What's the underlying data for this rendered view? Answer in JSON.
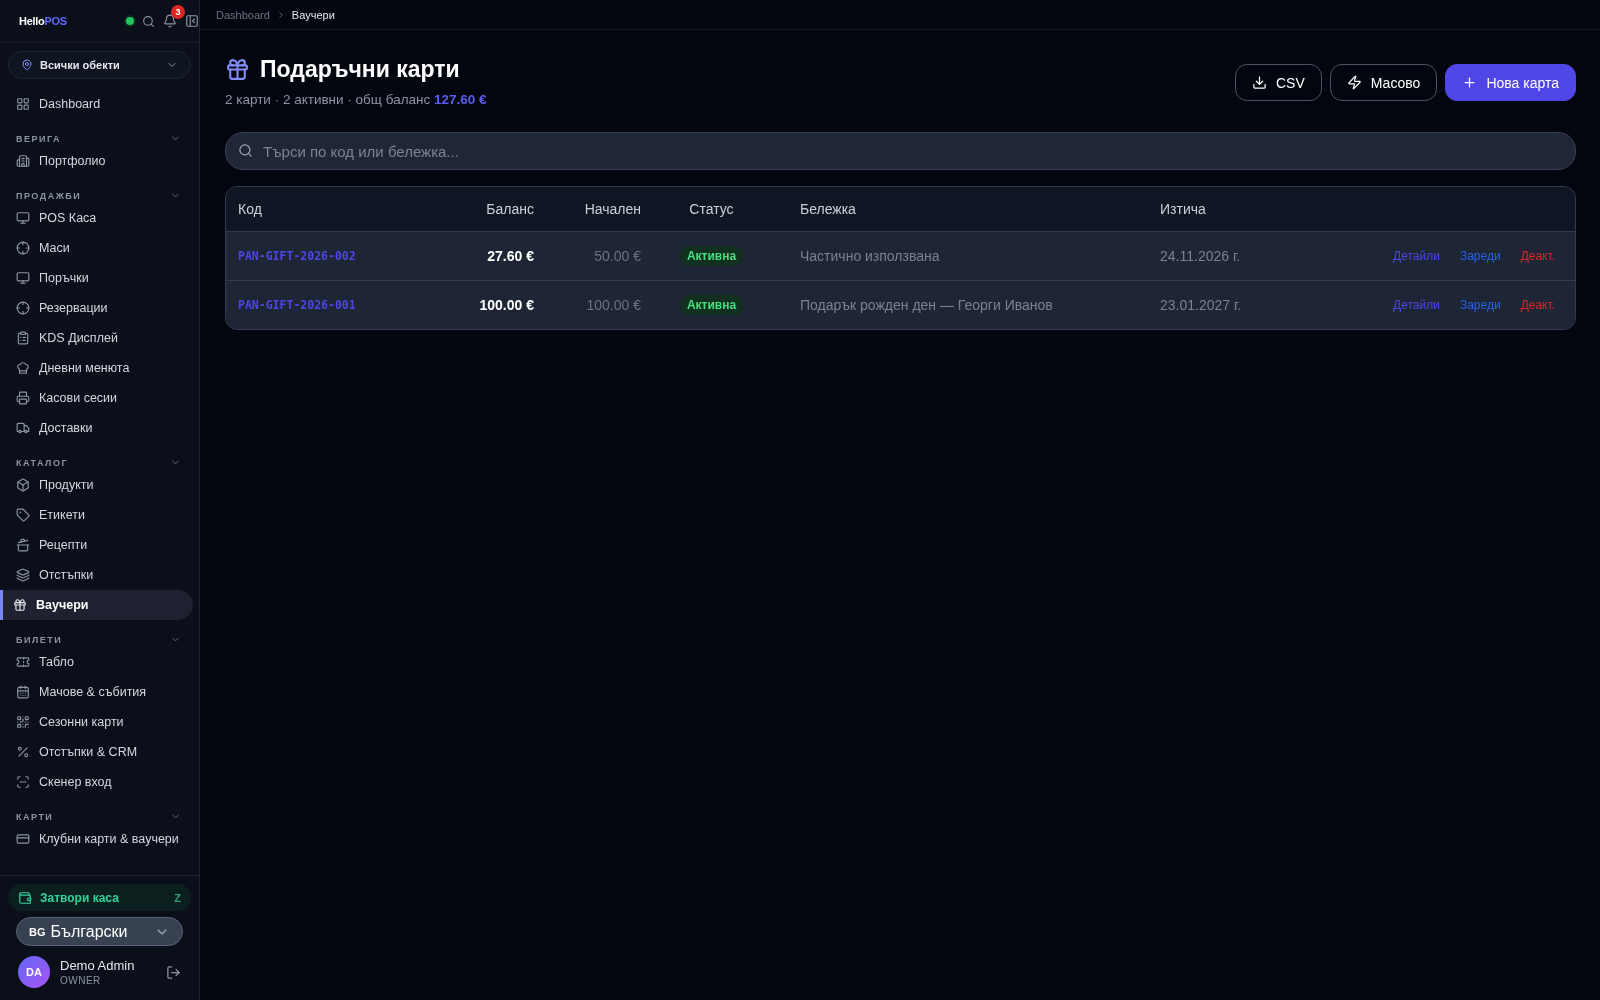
{
  "logo": {
    "text": "Hello",
    "accent": "POS"
  },
  "notifications": {
    "count": "3"
  },
  "location": {
    "value": "Всички обекти"
  },
  "nav": [
    {
      "label": "Dashboard",
      "selected": false
    }
  ],
  "sections": [
    {
      "title": "ВЕРИГА",
      "expanded": true,
      "items": [
        {
          "label": "Портфолио",
          "selected": false
        }
      ]
    },
    {
      "title": "ПРОДАЖБИ",
      "expanded": true,
      "items": [
        {
          "label": "POS Каса",
          "selected": false
        },
        {
          "label": "Маси",
          "selected": false
        },
        {
          "label": "Поръчки",
          "selected": false
        },
        {
          "label": "Резервации",
          "selected": false
        },
        {
          "label": "KDS Дисплей",
          "selected": false
        },
        {
          "label": "Дневни менюта",
          "selected": false
        },
        {
          "label": "Касови сесии",
          "selected": false
        },
        {
          "label": "Доставки",
          "selected": false
        }
      ]
    },
    {
      "title": "КАТАЛОГ",
      "expanded": true,
      "items": [
        {
          "label": "Продукти",
          "selected": false
        },
        {
          "label": "Етикети",
          "selected": false
        },
        {
          "label": "Рецепти",
          "selected": false
        },
        {
          "label": "Отстъпки",
          "selected": false
        },
        {
          "label": "Ваучери",
          "selected": true
        }
      ]
    },
    {
      "title": "БИЛЕТИ",
      "expanded": true,
      "items": [
        {
          "label": "Табло",
          "selected": false
        },
        {
          "label": "Мачове & събития",
          "selected": false
        },
        {
          "label": "Сезонни карти",
          "selected": false
        },
        {
          "label": "Отстъпки & CRM",
          "selected": false
        },
        {
          "label": "Скенер вход",
          "selected": false
        }
      ]
    },
    {
      "title": "КАРТИ",
      "expanded": true,
      "items": [
        {
          "label": "Клубни карти & ваучери",
          "selected": false
        }
      ]
    }
  ],
  "close_register": {
    "label": "Затвори каса",
    "shortcut": "Z"
  },
  "language": {
    "code": "BG",
    "value": "Български"
  },
  "user": {
    "initials": "DA",
    "name": "Demo Admin",
    "role": "OWNER"
  },
  "breadcrumb": [
    "Dashboard",
    "Ваучери"
  ],
  "title": "Подаръчни карти",
  "subtitle": {
    "text": "2 карти · 2 активни · общ баланс",
    "total": "127.60 €"
  },
  "buttons": [
    {
      "label": "CSV",
      "kind": "outline"
    },
    {
      "label": "Масово",
      "kind": "outline"
    },
    {
      "label": "Нова карта",
      "kind": "primary"
    }
  ],
  "search": {
    "placeholder": "Търси по код или бележка..."
  },
  "table": {
    "columns": [
      "Код",
      "Баланс",
      "Начален",
      "Статус",
      "Бележка",
      "Изтича"
    ],
    "rows": [
      {
        "code": "PAN-GIFT-2026-002",
        "balance": "27.60 €",
        "initial": "50.00 €",
        "status": {
          "label": "Активна",
          "kind": "active"
        },
        "note": "Частично използвана",
        "expires": "24.11.2026 г.",
        "actions": [
          {
            "label": "Детайли",
            "kind": "details"
          },
          {
            "label": "Зареди",
            "kind": "charge"
          },
          {
            "label": "Деакт.",
            "kind": "deactivate"
          }
        ]
      },
      {
        "code": "PAN-GIFT-2026-001",
        "balance": "100.00 €",
        "initial": "100.00 €",
        "status": {
          "label": "Активна",
          "kind": "active"
        },
        "note": "Подарък рожден ден — Георги Иванов",
        "expires": "23.01.2027 г.",
        "actions": [
          {
            "label": "Детайли",
            "kind": "details"
          },
          {
            "label": "Зареди",
            "kind": "charge"
          },
          {
            "label": "Деакт.",
            "kind": "deactivate"
          }
        ]
      }
    ]
  }
}
